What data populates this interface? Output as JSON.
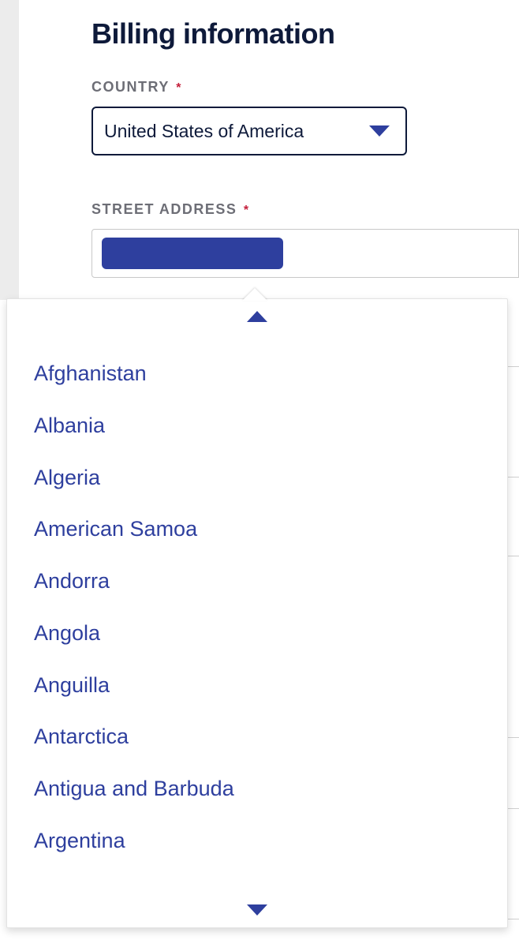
{
  "heading": "Billing information",
  "country": {
    "label": "COUNTRY",
    "required_marker": "*",
    "value": "United States of America"
  },
  "street": {
    "label": "STREET ADDRESS",
    "required_marker": "*"
  },
  "dropdown": {
    "options": [
      "Afghanistan",
      "Albania",
      "Algeria",
      "American Samoa",
      "Andorra",
      "Angola",
      "Anguilla",
      "Antarctica",
      "Antigua and Barbuda",
      "Argentina"
    ]
  },
  "colors": {
    "heading": "#0e1a3a",
    "label": "#6d6e76",
    "required": "#c41e3a",
    "accent": "#2e3f9e"
  }
}
